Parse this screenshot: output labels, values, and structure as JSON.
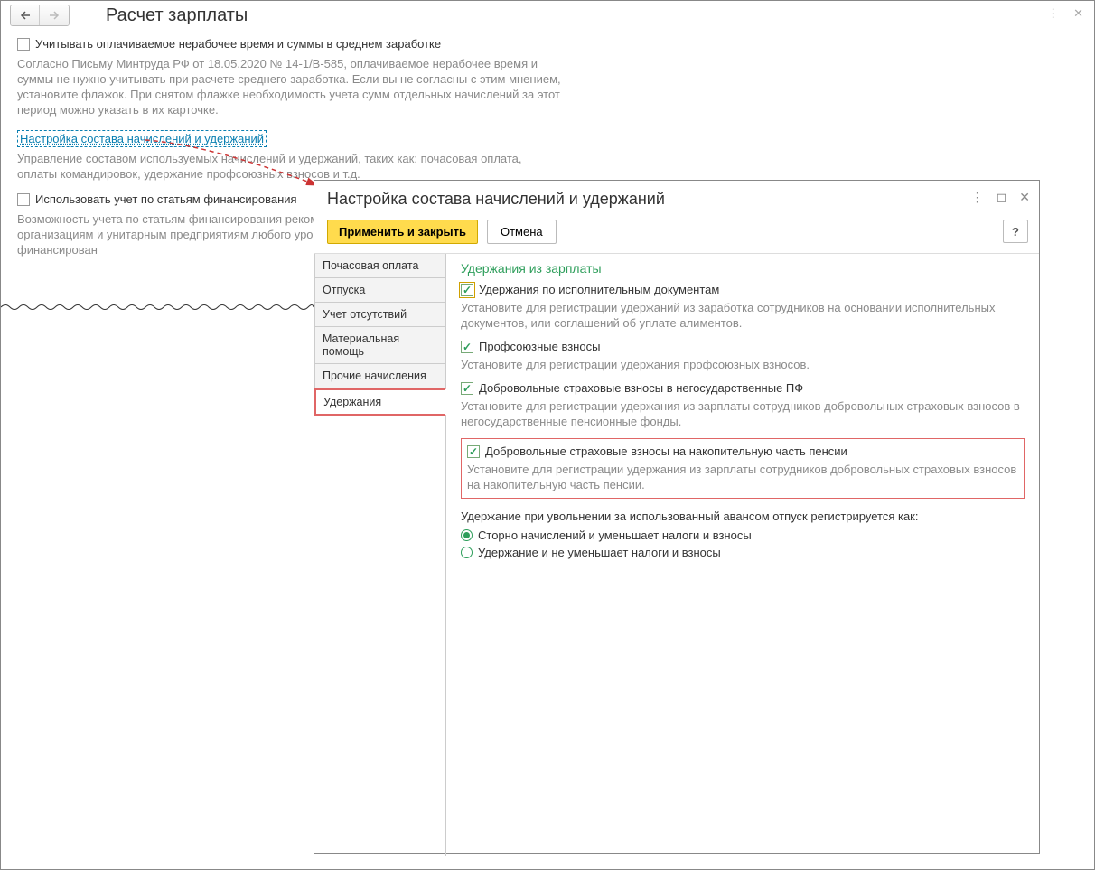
{
  "page": {
    "title": "Расчет зарплаты",
    "check1_label": "Учитывать оплачиваемое нерабочее время и суммы в среднем заработке",
    "desc1": "Согласно Письму Минтруда РФ от 18.05.2020 № 14-1/В-585, оплачиваемое нерабочее время и суммы не нужно учитывать при расчете среднего заработка. Если вы не согласны с этим мнением, установите флажок. При снятом флажке необходимость учета сумм отдельных начислений за этот период можно указать в их карточке.",
    "link_label": "Настройка состава начислений и удержаний",
    "link_desc": "Управление составом используемых начислений и удержаний, таких как: почасовая оплата, оплаты командировок, удержание профсоюзных взносов и т.д.",
    "check2_label": "Использовать учет по статьям финансирования",
    "desc2": "Возможность учета по статьям финансирования рекомендуется использовать некоммерческим организациям и унитарным предприятиям любого уровня только при наличии целевого финансирован"
  },
  "dialog": {
    "title": "Настройка состава начислений и удержаний",
    "apply_close": "Применить и закрыть",
    "cancel": "Отмена",
    "help": "?",
    "tabs": [
      "Почасовая оплата",
      "Отпуска",
      "Учет отсутствий",
      "Материальная помощь",
      "Прочие начисления",
      "Удержания"
    ],
    "pane": {
      "title": "Удержания из зарплаты",
      "opt1_label": "Удержания по исполнительным документам",
      "opt1_desc": "Установите для регистрации удержаний из заработка сотрудников на основании исполнительных документов, или соглашений об уплате алиментов.",
      "opt2_label": "Профсоюзные взносы",
      "opt2_desc": "Установите для регистрации удержания профсоюзных взносов.",
      "opt3_label": "Добровольные страховые взносы в негосударственные ПФ",
      "opt3_desc": "Установите для регистрации удержания из зарплаты сотрудников добровольных страховых взносов в негосударственные пенсионные фонды.",
      "opt4_label": "Добровольные страховые взносы на накопительную часть пенсии",
      "opt4_desc": "Установите для регистрации удержания из зарплаты сотрудников добровольных страховых взносов на накопительную часть пенсии.",
      "question": "Удержание при увольнении за использованный авансом отпуск регистрируется как:",
      "radio1": "Сторно начислений и уменьшает налоги и взносы",
      "radio2": "Удержание и не уменьшает налоги и взносы"
    }
  }
}
